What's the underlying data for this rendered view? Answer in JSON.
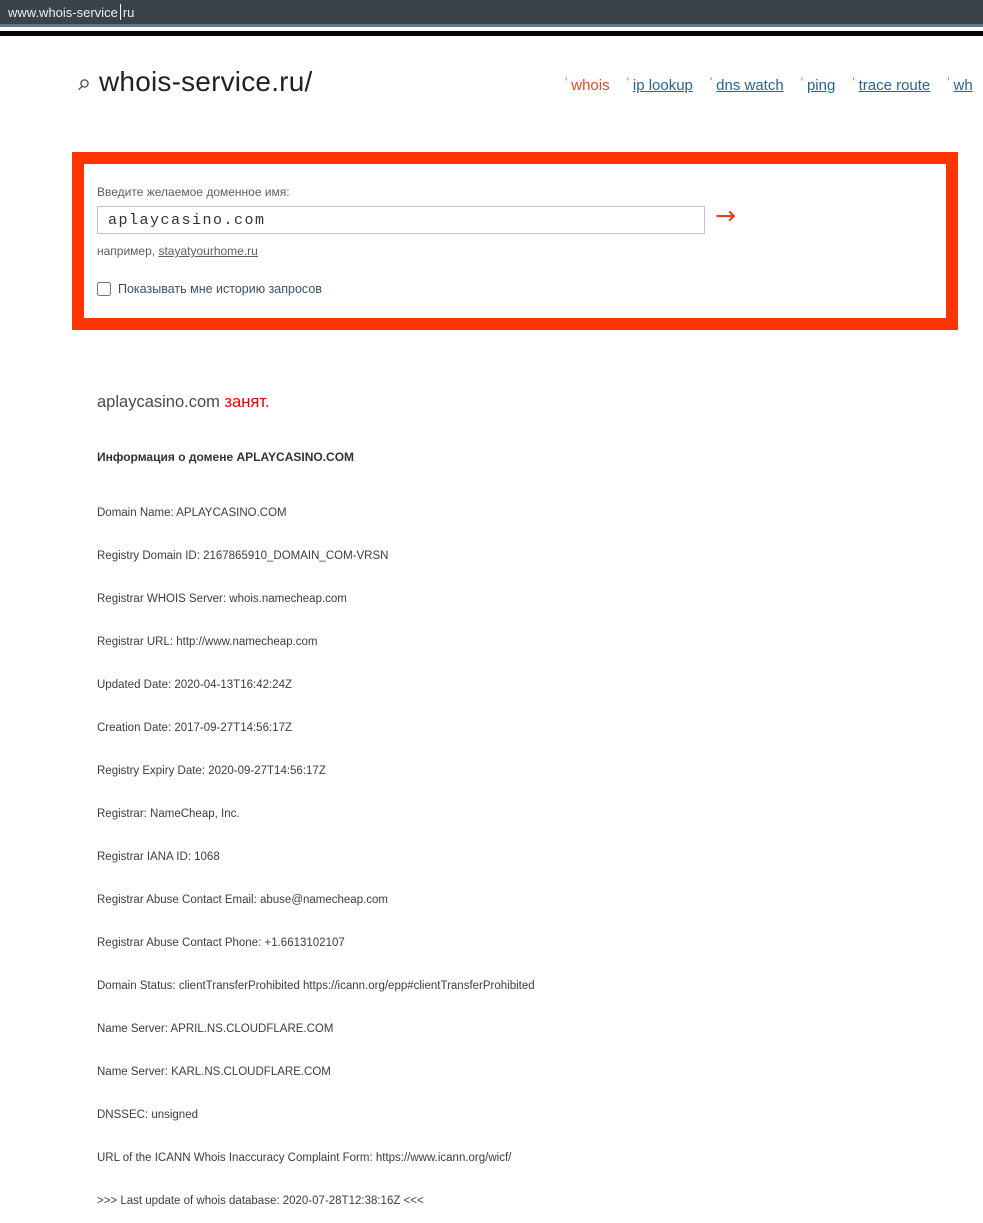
{
  "browser": {
    "address_prefix": "www.whois-service",
    "address_suffix": "ru"
  },
  "header": {
    "logo_text": "whois-service.ru/",
    "nav": [
      {
        "label": "whois",
        "active": true
      },
      {
        "label": "ip lookup",
        "active": false
      },
      {
        "label": "dns watch",
        "active": false
      },
      {
        "label": "ping",
        "active": false
      },
      {
        "label": "trace route",
        "active": false
      },
      {
        "label": "wh",
        "active": false
      }
    ]
  },
  "search_box": {
    "label": "Введите желаемое доменное имя:",
    "input_value": "aplaycasino.com",
    "submit_arrow": "→",
    "example_prefix": "например, ",
    "example_link": "stayatyourhome.ru",
    "checkbox_label": "Показывать мне историю запросов",
    "checkbox_checked": false
  },
  "result": {
    "domain": "aplaycasino.com ",
    "status_text": "занят.",
    "info_heading": "Информация о домене APLAYCASINO.COM",
    "whois_lines": [
      "Domain Name: APLAYCASINO.COM",
      "Registry Domain ID: 2167865910_DOMAIN_COM-VRSN",
      "Registrar WHOIS Server: whois.namecheap.com",
      "Registrar URL: http://www.namecheap.com",
      "Updated Date: 2020-04-13T16:42:24Z",
      "Creation Date: 2017-09-27T14:56:17Z",
      "Registry Expiry Date: 2020-09-27T14:56:17Z",
      "Registrar: NameCheap, Inc.",
      "Registrar IANA ID: 1068",
      "Registrar Abuse Contact Email: abuse@namecheap.com",
      "Registrar Abuse Contact Phone: +1.6613102107",
      "Domain Status: clientTransferProhibited https://icann.org/epp#clientTransferProhibited",
      "Name Server: APRIL.NS.CLOUDFLARE.COM",
      "Name Server: KARL.NS.CLOUDFLARE.COM",
      "DNSSEC: unsigned",
      "URL of the ICANN Whois Inaccuracy Complaint Form: https://www.icann.org/wicf/",
      ">>> Last update of whois database: 2020-07-28T12:38:16Z <<<"
    ]
  },
  "colors": {
    "box_border_red": "#ff3400",
    "accent_orange": "#e8471f",
    "link_blue": "#2a6291",
    "status_red": "#e30000",
    "topbar_bg": "#3a424b",
    "topbar_line": "#5f7889"
  }
}
